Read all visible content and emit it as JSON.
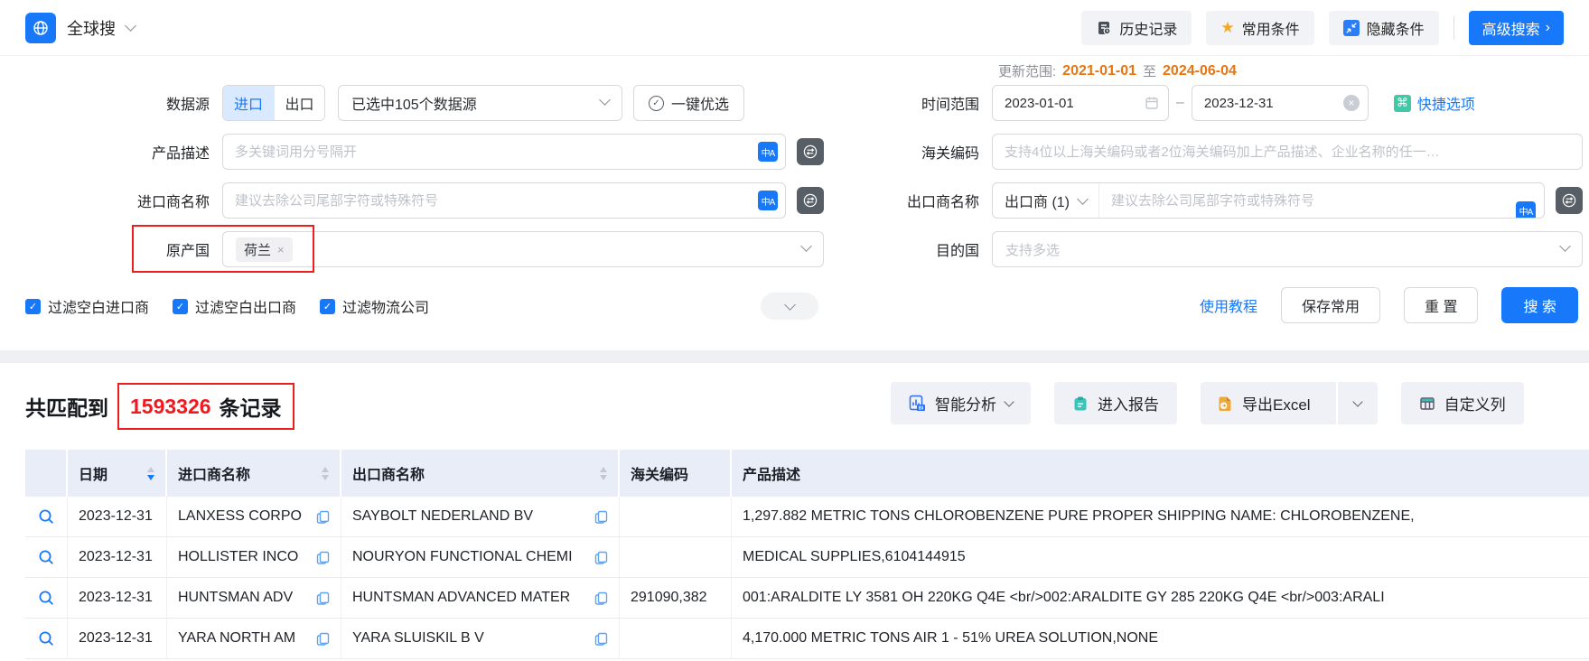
{
  "colors": {
    "accent": "#1779fa",
    "update_orange": "#e8750f",
    "annotation_red": "#ec1f1f",
    "count_red": "#f0191f",
    "report_teal": "#39c5b9",
    "excel_orange": "#eda93c",
    "header_bg": "#e9edf8"
  },
  "topbar": {
    "app_name": "全球搜",
    "history_label": "历史记录",
    "favorites_label": "常用条件",
    "hide_label": "隐藏条件",
    "advanced_label": "高级搜索",
    "advanced_arrow": "›"
  },
  "filters": {
    "update_range": {
      "label": "更新范围:",
      "start": "2021-01-01",
      "to": "至",
      "end": "2024-06-04"
    },
    "data_source": {
      "label": "数据源",
      "import_tab": "进口",
      "export_tab": "出口",
      "selected_summary": "已选中105个数据源",
      "optimize_label": "一键优选"
    },
    "time_range": {
      "label": "时间范围",
      "start": "2023-01-01",
      "separator": "–",
      "end": "2023-12-31",
      "quick_label": "快捷选项"
    },
    "product_desc": {
      "label": "产品描述",
      "placeholder": "多关键词用分号隔开"
    },
    "hs_code": {
      "label": "海关编码",
      "placeholder": "支持4位以上海关编码或者2位海关编码加上产品描述、企业名称的任一…"
    },
    "importer": {
      "label": "进口商名称",
      "placeholder": "建议去除公司尾部字符或特殊符号"
    },
    "exporter": {
      "label": "出口商名称",
      "type_selected": "出口商 (1)",
      "placeholder": "建议去除公司尾部字符或特殊符号"
    },
    "origin": {
      "label": "原产国",
      "tag": "荷兰"
    },
    "destination": {
      "label": "目的国",
      "placeholder": "支持多选"
    },
    "checkboxes": [
      {
        "label": "过滤空白进口商",
        "checked": true
      },
      {
        "label": "过滤空白出口商",
        "checked": true
      },
      {
        "label": "过滤物流公司",
        "checked": true
      }
    ],
    "tutorial_label": "使用教程",
    "save_label": "保存常用",
    "reset_label": "重 置",
    "search_label": "搜 索"
  },
  "results": {
    "match_prefix": "共匹配到",
    "match_count": "1593326",
    "match_suffix": "条记录",
    "analysis_label": "智能分析",
    "report_label": "进入报告",
    "export_label": "导出Excel",
    "custom_columns_label": "自定义列"
  },
  "table": {
    "columns": [
      {
        "label": "日期",
        "sort": "desc"
      },
      {
        "label": "进口商名称",
        "sort": "none"
      },
      {
        "label": "出口商名称",
        "sort": "none"
      },
      {
        "label": "海关编码"
      },
      {
        "label": "产品描述"
      }
    ],
    "rows": [
      {
        "date": "2023-12-31",
        "importer": "LANXESS CORPO",
        "exporter": "SAYBOLT NEDERLAND BV",
        "hs_code": "",
        "product": "1,297.882 METRIC TONS CHLOROBENZENE PURE PROPER SHIPPING NAME: CHLOROBENZENE,"
      },
      {
        "date": "2023-12-31",
        "importer": "HOLLISTER INCO",
        "exporter": "NOURYON FUNCTIONAL CHEMI",
        "hs_code": "",
        "product": "MEDICAL SUPPLIES,6104144915"
      },
      {
        "date": "2023-12-31",
        "importer": "HUNTSMAN ADV",
        "exporter": "HUNTSMAN ADVANCED MATER",
        "hs_code": "291090,382",
        "product": "001:ARALDITE LY 3581 OH 220KG Q4E <br/>002:ARALDITE GY 285 220KG Q4E <br/>003:ARALI"
      },
      {
        "date": "2023-12-31",
        "importer": "YARA NORTH AM",
        "exporter": "YARA SLUISKIL B V",
        "hs_code": "",
        "product": "4,170.000 METRIC TONS AIR 1 - 51% UREA SOLUTION,NONE"
      }
    ]
  },
  "icons": {
    "star": "★",
    "check": "✓",
    "close": "×",
    "shortcut": "⌘",
    "translate": "中A",
    "dash": "–",
    "logo": "globe",
    "magnifier": "search",
    "copy": "copy-document",
    "exclude": "exclude-circle"
  }
}
